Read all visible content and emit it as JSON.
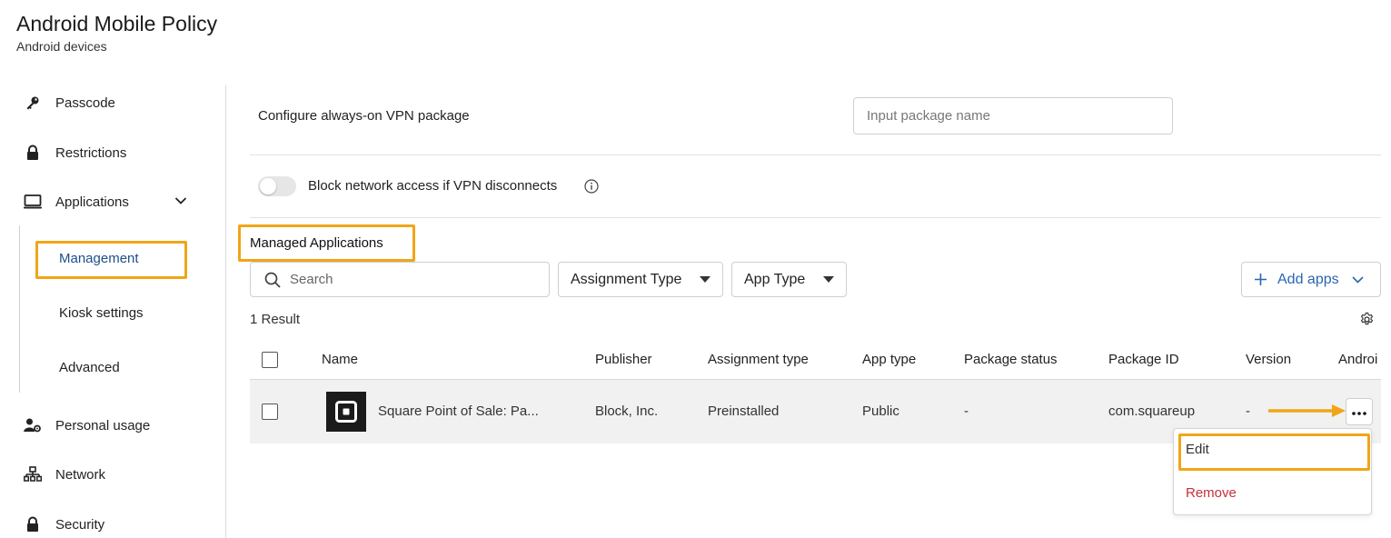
{
  "header": {
    "title": "Android Mobile Policy",
    "subtitle": "Android devices"
  },
  "sidebar": {
    "items": [
      {
        "label": "Passcode",
        "icon": "key-icon"
      },
      {
        "label": "Restrictions",
        "icon": "lock-icon"
      },
      {
        "label": "Applications",
        "icon": "monitor-icon"
      },
      {
        "label": "Personal usage",
        "icon": "user-gear-icon"
      },
      {
        "label": "Network",
        "icon": "network-icon"
      },
      {
        "label": "Security",
        "icon": "lock-icon"
      }
    ],
    "sub_items": [
      {
        "label": "Management",
        "active": true
      },
      {
        "label": "Kiosk settings",
        "active": false
      },
      {
        "label": "Advanced",
        "active": false
      }
    ]
  },
  "vpn": {
    "label": "Configure always-on VPN package",
    "placeholder": "Input package name",
    "block_label": "Block network access if VPN disconnects",
    "block_enabled": false
  },
  "managed_apps": {
    "title": "Managed Applications",
    "search_placeholder": "Search",
    "filters": [
      "Assignment Type",
      "App Type"
    ],
    "add_label": "Add apps",
    "result_count": "1 Result",
    "columns": [
      "Name",
      "Publisher",
      "Assignment type",
      "App type",
      "Package status",
      "Package ID",
      "Version",
      "Androi"
    ],
    "rows": [
      {
        "name": "Square Point of Sale: Pa...",
        "publisher": "Block, Inc.",
        "assignment_type": "Preinstalled",
        "app_type": "Public",
        "package_status": "-",
        "package_id": "com.squareup",
        "version": "-"
      }
    ],
    "row_menu": [
      "Edit",
      "Remove"
    ]
  },
  "colors": {
    "accent": "#2a66b0",
    "highlight": "#f0a518",
    "danger": "#c62f3a",
    "active_nav": "#1d4f8a"
  }
}
